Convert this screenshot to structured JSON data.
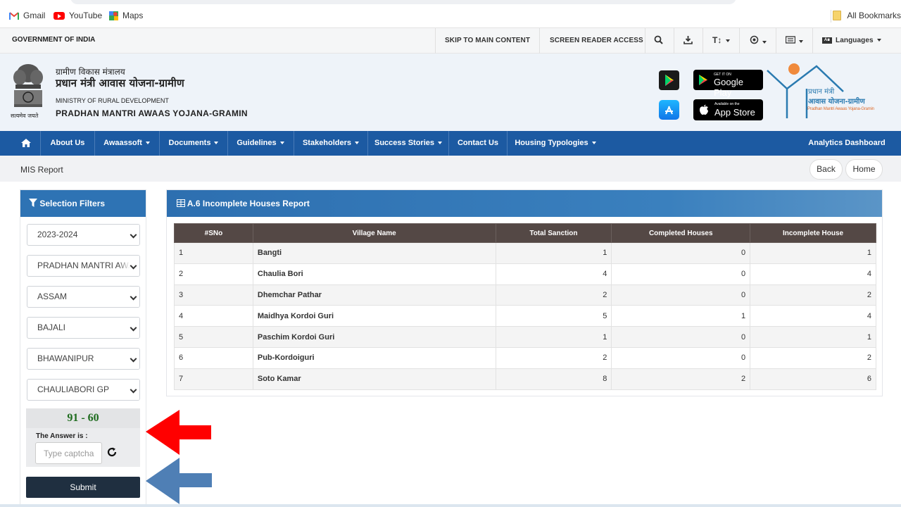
{
  "browser": {
    "bookmarks": [
      {
        "label": "Gmail",
        "icon": "gmail-icon"
      },
      {
        "label": "YouTube",
        "icon": "youtube-icon"
      },
      {
        "label": "Maps",
        "icon": "maps-icon"
      }
    ],
    "all_bookmarks": "All Bookmarks"
  },
  "gov_bar": {
    "title": "GOVERNMENT OF INDIA",
    "skip": "SKIP TO MAIN CONTENT",
    "screen_reader": "SCREEN READER ACCESS",
    "text_size": "T↕",
    "languages": "Languages",
    "lang_badge": "A∎"
  },
  "header": {
    "ministry_hi": "ग्रामीण विकास मंत्रालय",
    "scheme_hi": "प्रधान मंत्री आवास योजना-ग्रामीण",
    "ministry_en": "MINISTRY OF RURAL DEVELOPMENT",
    "scheme_en": "PRADHAN MANTRI AWAAS YOJANA-GRAMIN",
    "emblem_caption": "सत्यमेव जयते",
    "google_play_sub": "GET IT ON",
    "google_play": "Google Play",
    "app_store_sub": "Available on the",
    "app_store": "App Store",
    "logo_line1": "प्रधान मंत्री",
    "logo_line2": "आवास योजना-ग्रामीण",
    "logo_line3": "Pradhan Mantri Awaas Yojana-Gramin"
  },
  "nav": {
    "home_icon": "home-icon",
    "items": [
      "About Us",
      "Awaassoft",
      "Documents",
      "Guidelines",
      "Stakeholders",
      "Success Stories",
      "Contact Us",
      "Housing Typologies"
    ],
    "analytics": "Analytics Dashboard"
  },
  "breadcrumb": {
    "title": "MIS Report",
    "back": "Back",
    "home": "Home"
  },
  "filters": {
    "heading": "Selection Filters",
    "selects": [
      "2023-2024",
      "PRADHAN MANTRI AWAAS YOJANA",
      "ASSAM",
      "BAJALI",
      "BHAWANIPUR",
      "CHAULIABORI GP"
    ],
    "captcha_code": "91 - 60",
    "answer_label": "The Answer is :",
    "captcha_placeholder": "Type captcha",
    "submit": "Submit"
  },
  "report": {
    "heading": "A.6 Incomplete Houses Report",
    "columns": [
      "#SNo",
      "Village Name",
      "Total Sanction",
      "Completed Houses",
      "Incomplete House"
    ],
    "rows": [
      [
        "1",
        "Bangti",
        "1",
        "0",
        "1"
      ],
      [
        "2",
        "Chaulia Bori",
        "4",
        "0",
        "4"
      ],
      [
        "3",
        "Dhemchar Pathar",
        "2",
        "0",
        "2"
      ],
      [
        "4",
        "Maidhya Kordoi Guri",
        "5",
        "1",
        "4"
      ],
      [
        "5",
        "Paschim Kordoi Guri",
        "1",
        "0",
        "1"
      ],
      [
        "6",
        "Pub-Kordoiguri",
        "2",
        "0",
        "2"
      ],
      [
        "7",
        "Soto Kamar",
        "8",
        "2",
        "6"
      ]
    ]
  },
  "colors": {
    "nav_blue": "#1c5aa2",
    "panel_blue": "#2e73b4",
    "table_header": "#544845",
    "submit": "#1f2f40",
    "captcha_text": "#1d6b1d",
    "red_arrow": "#ff0000",
    "blue_arrow": "#4f7fb5"
  }
}
